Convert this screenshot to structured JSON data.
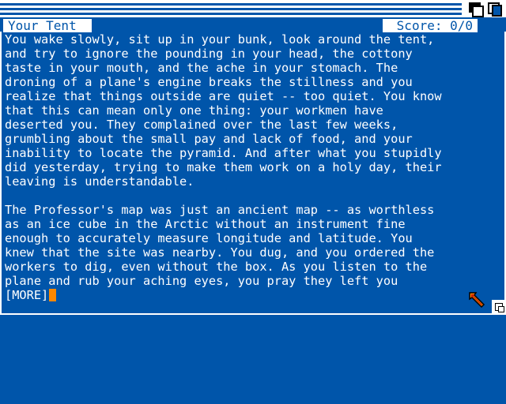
{
  "status": {
    "location": "Your Tent",
    "score": "Score: 0/0"
  },
  "story": {
    "paragraphs": [
      "You wake slowly, sit up in your bunk, look around the tent,\nand try to ignore the pounding in your head, the cottony\ntaste in your mouth, and the ache in your stomach. The\ndroning of a plane's engine breaks the stillness and you\nrealize that things outside are quiet -- too quiet. You know\nthat this can mean only one thing: your workmen have\ndeserted you. They complained over the last few weeks,\ngrumbling about the small pay and lack of food, and your\ninability to locate the pyramid. And after what you stupidly\ndid yesterday, trying to make them work on a holy day, their\nleaving is understandable.",
      "The Professor's map was just an ancient map -- as worthless\nas an ice cube in the Arctic without an instrument fine\nenough to accurately measure longitude and latitude. You\nknew that the site was nearby. You dug, and you ordered the\nworkers to dig, even without the box. As you listen to the\nplane and rub your aching eyes, you pray they left you"
    ],
    "more_prompt": "[MORE]"
  },
  "colors": {
    "background": "#0055aa",
    "text": "#ffffff",
    "cursor": "#ff8800"
  },
  "icons": {
    "depth_gadget": "depth-arrange-icon",
    "zoom_gadget": "zoom-icon",
    "pointer": "mouse-pointer-icon",
    "sizing_gadget": "window-resize-icon"
  }
}
